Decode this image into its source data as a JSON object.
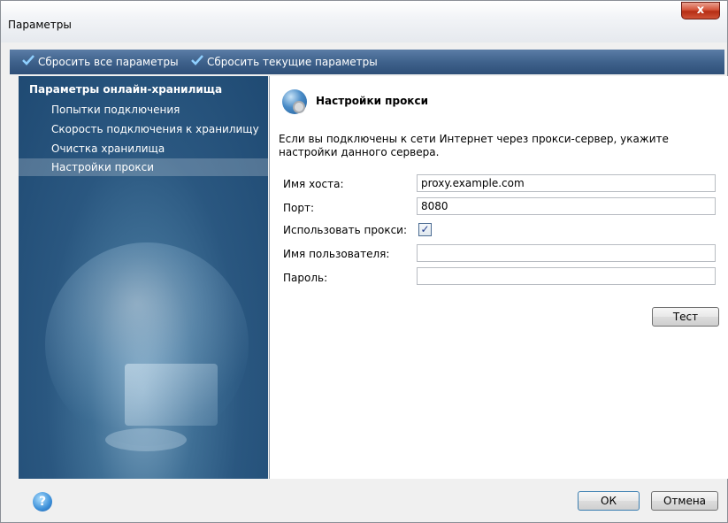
{
  "window": {
    "title": "Параметры",
    "close_label": "x"
  },
  "toolbar": {
    "reset_all": "Сбросить все параметры",
    "reset_current": "Сбросить текущие параметры"
  },
  "sidebar": {
    "header": "Параметры онлайн-хранилища",
    "items": [
      {
        "label": "Попытки подключения"
      },
      {
        "label": "Скорость подключения к хранилищу"
      },
      {
        "label": "Очистка хранилища"
      },
      {
        "label": "Настройки прокси",
        "active": true
      }
    ]
  },
  "content": {
    "title": "Настройки прокси",
    "description": "Если вы подключены к сети Интернет через прокси-сервер, укажите настройки данного сервера.",
    "fields": {
      "host_label": "Имя хоста:",
      "host_value": "proxy.example.com",
      "port_label": "Порт:",
      "port_value": "8080",
      "use_proxy_label": "Использовать прокси:",
      "use_proxy_checked": true,
      "username_label": "Имя пользователя:",
      "username_value": "",
      "password_label": "Пароль:",
      "password_value": ""
    },
    "test_button": "Тест"
  },
  "footer": {
    "ok": "ОК",
    "cancel": "Отмена",
    "help_glyph": "?"
  },
  "icons": {
    "toolbar_icon": "checkmark-icon",
    "header_icon": "globe-gear-icon",
    "help_icon": "help-icon",
    "close_icon": "close-icon"
  }
}
